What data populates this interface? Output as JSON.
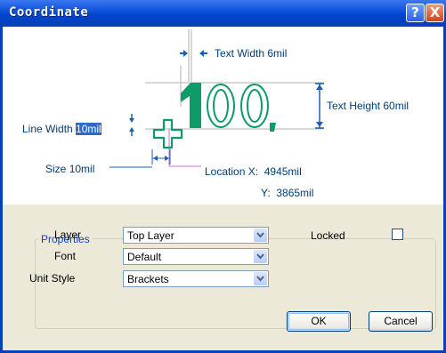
{
  "window": {
    "title": "Coordinate",
    "help_label": "?",
    "close_label": "X"
  },
  "diagram": {
    "text_width": "Text Width",
    "text_width_value": "6mil",
    "text_height": "Text Height",
    "text_height_value": "60mil",
    "line_width": "Line Width",
    "line_width_value": "10mil",
    "size": "Size",
    "size_value": "10mil",
    "location": "Location",
    "x_label": "X:",
    "x_value": "4945mil",
    "y_label": "Y:",
    "y_value": "3865mil",
    "sample_text": "100,",
    "accent_color": "#0f9a6a"
  },
  "properties": {
    "legend": "Properties",
    "layer_label": "Layer",
    "layer_value": "Top Layer",
    "font_label": "Font",
    "font_value": "Default",
    "unit_style_label": "Unit Style",
    "unit_style_value": "Brackets",
    "locked_label": "Locked",
    "locked_checked": false
  },
  "buttons": {
    "ok": "OK",
    "cancel": "Cancel"
  }
}
